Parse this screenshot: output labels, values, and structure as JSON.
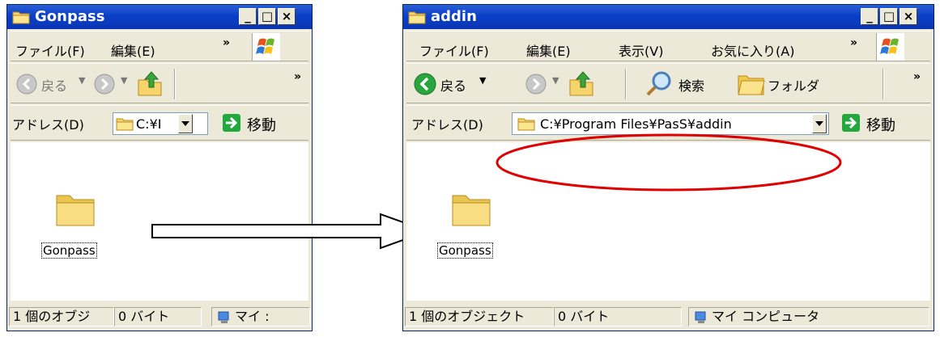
{
  "left_window": {
    "title": "Gonpass",
    "menu": [
      "ファイル(F)",
      "編集(E)"
    ],
    "back_label": "戻る",
    "address_label": "アドレス(D)",
    "address_value": "C:¥I",
    "go_label": "移動",
    "file_name": "Gonpass",
    "status": [
      "1 個のオブジ",
      "0 バイト",
      "マイ :"
    ]
  },
  "right_window": {
    "title": "addin",
    "menu": [
      "ファイル(F)",
      "編集(E)",
      "表示(V)",
      "お気に入り(A)"
    ],
    "back_label": "戻る",
    "search_label": "検索",
    "folders_label": "フォルダ",
    "address_label": "アドレス(D)",
    "address_value": "C:¥Program Files¥PasS¥addin",
    "go_label": "移動",
    "file_name": "Gonpass",
    "status": [
      "1 個のオブジェクト",
      "0 バイト",
      "マイ コンピュータ"
    ]
  },
  "colors": {
    "titlebar": "#0a3fc8",
    "highlight_ellipse": "#e00000",
    "go_green": "#22a83c"
  }
}
